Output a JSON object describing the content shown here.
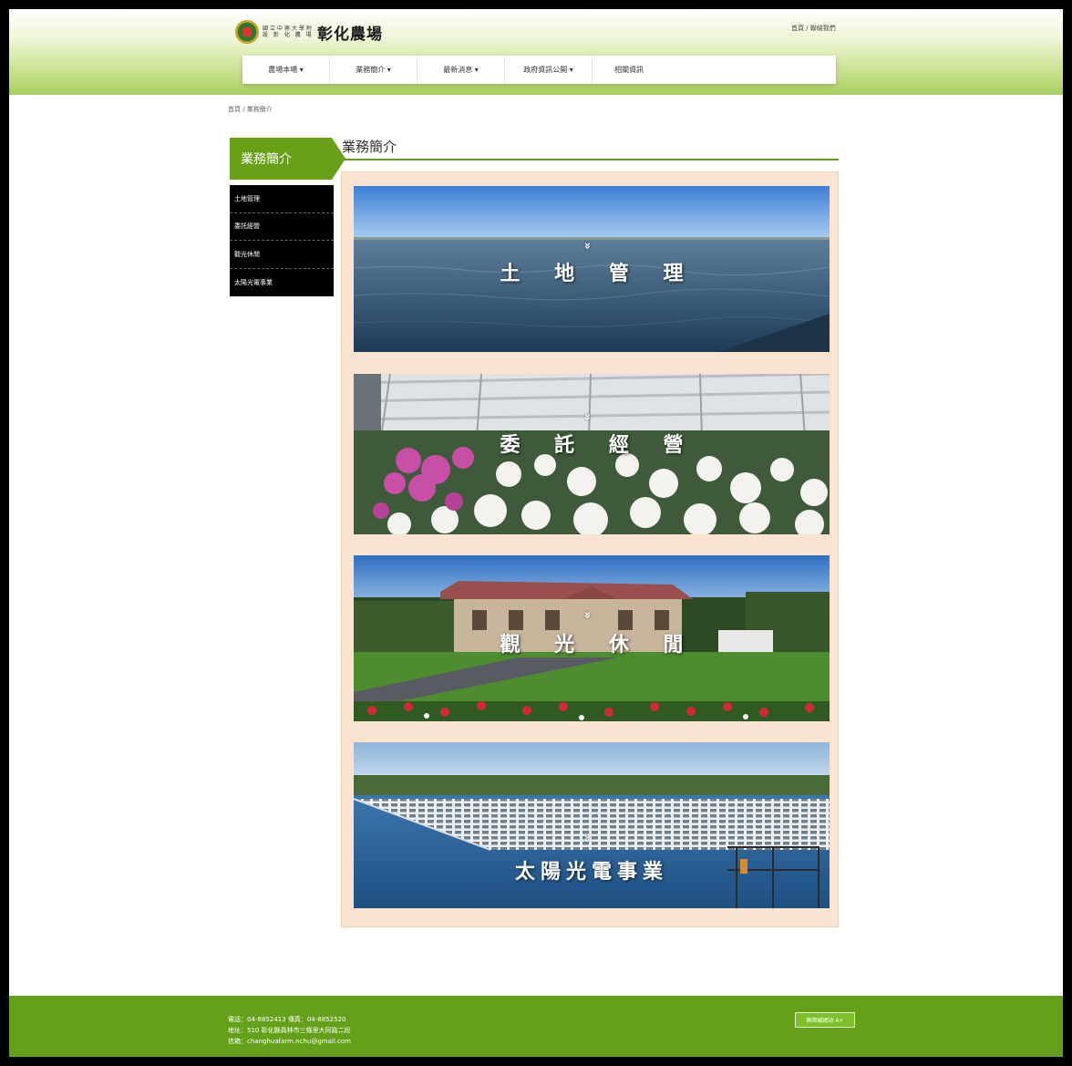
{
  "header": {
    "logo_small_lines": [
      "國立中興大學附",
      "設 彰 化 農 場"
    ],
    "logo_name": "彰化農場",
    "top_link": "首頁 / 聯絡我們",
    "nav": [
      "農場本場 ▾",
      "業務簡介 ▾",
      "最新消息 ▾",
      "政府資訊公開 ▾",
      "相關資訊"
    ]
  },
  "breadcrumb": "首頁 / 業務簡介",
  "sidebar": {
    "title": "業務簡介",
    "items": [
      "土地管理",
      "委託經營",
      "觀光休閒",
      "太陽光電事業"
    ]
  },
  "main": {
    "title": "業務簡介",
    "cards": [
      {
        "label": "土 地 管 理"
      },
      {
        "label": "委 託 經 營"
      },
      {
        "label": "觀 光 休 閒"
      },
      {
        "label": "太陽光電事業"
      }
    ]
  },
  "footer": {
    "lines": [
      "電話：04-8852413 傳真：04-8852520",
      "地址：510 彰化縣員林市三條里大同路二段",
      "信箱：changhuafarm.nchu@gmail.com"
    ],
    "badge": "無障礙網站 A+"
  },
  "colors": {
    "green": "#68a017",
    "panel": "#fae3d0",
    "footer": "#64a01a"
  }
}
